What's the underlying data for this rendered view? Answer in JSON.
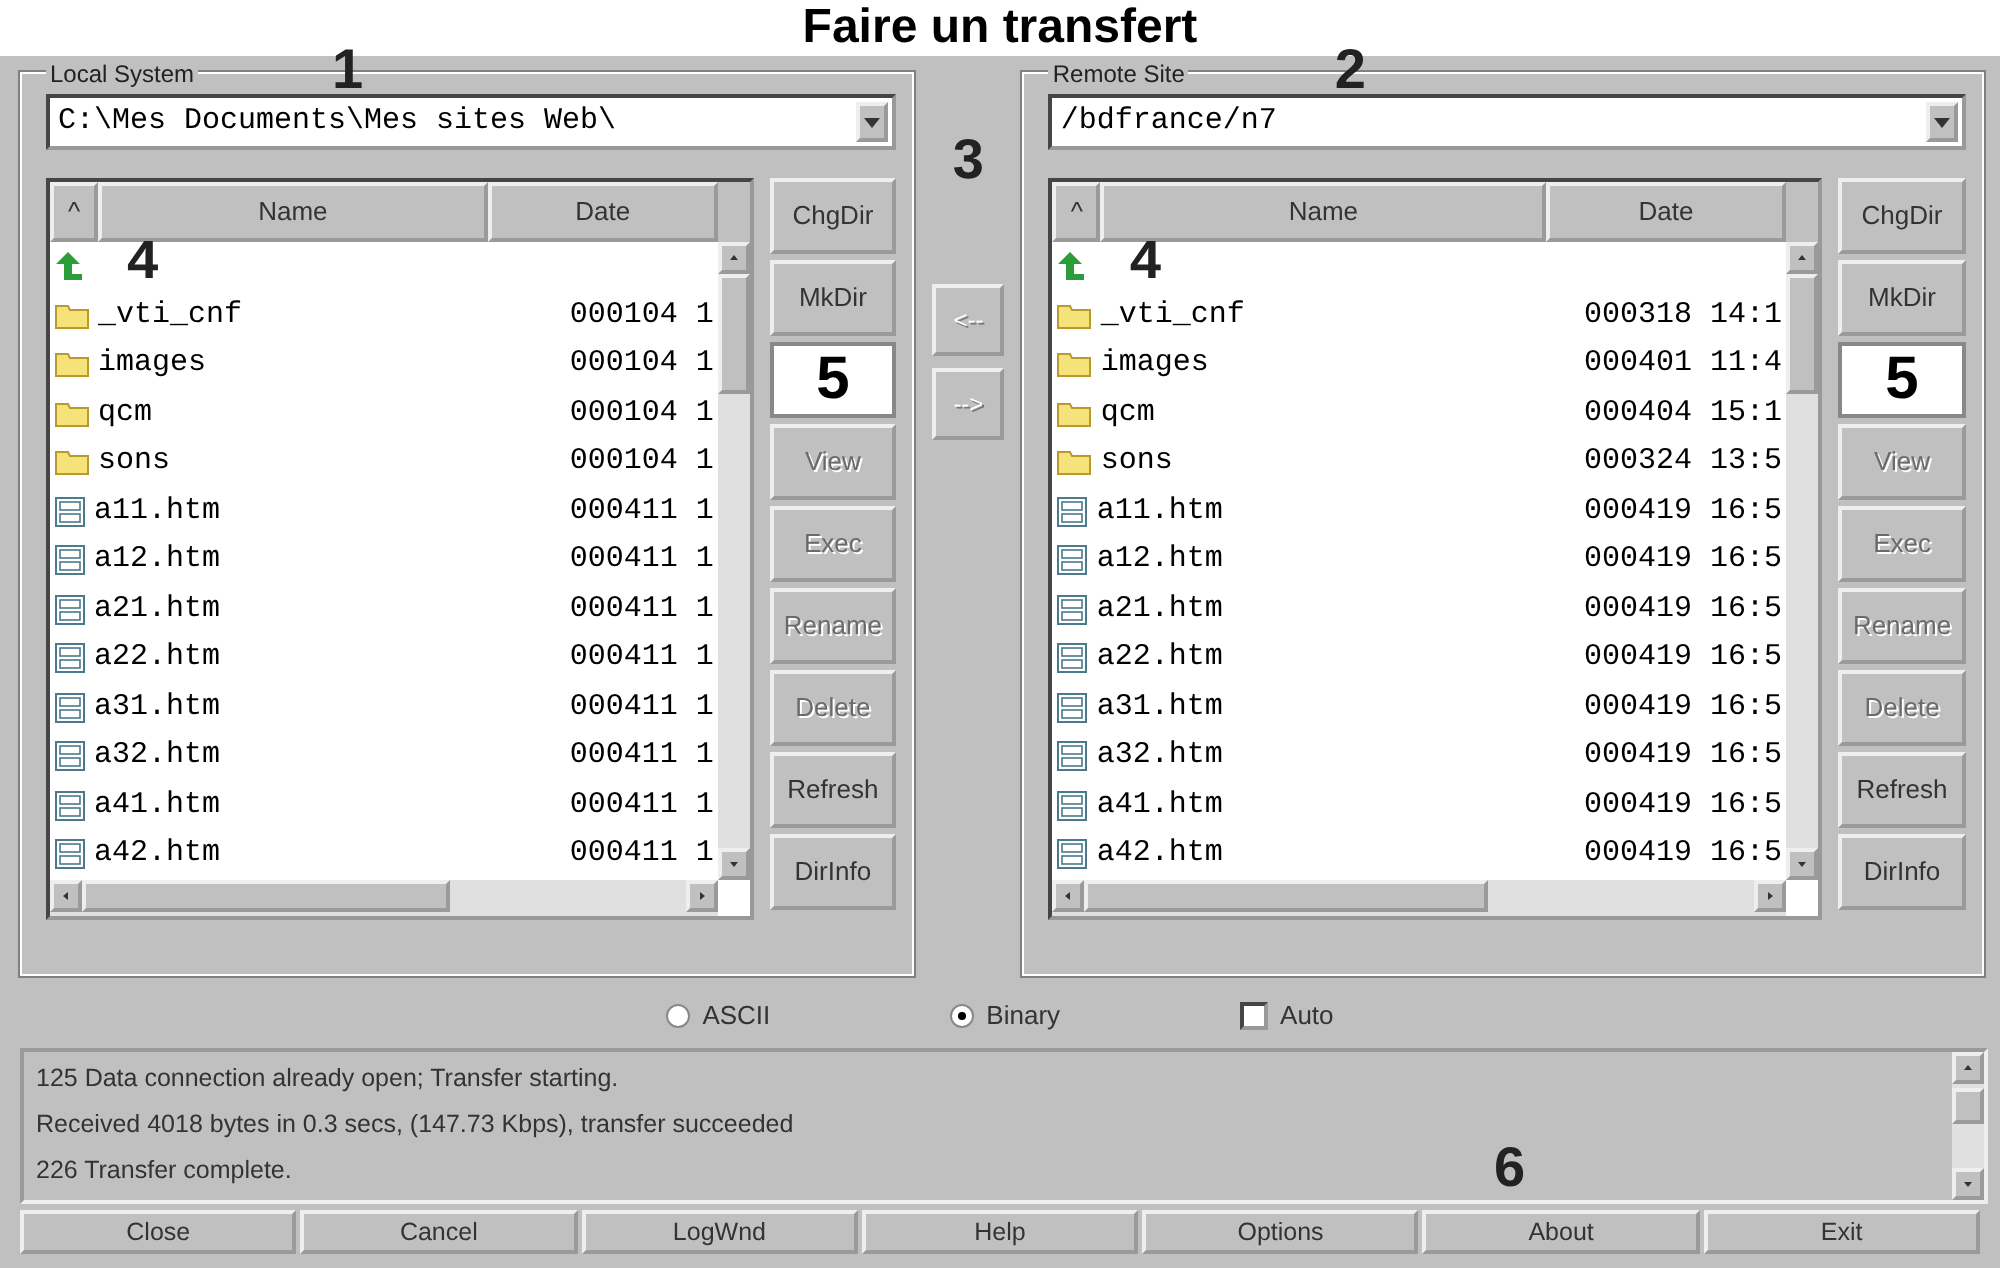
{
  "title": "Faire un transfert",
  "panels": [
    {
      "label": "Local System",
      "marker": "1",
      "path": "C:\\Mes Documents\\Mes sites Web\\",
      "columns": [
        "^",
        "Name",
        "Date"
      ],
      "rows": [
        {
          "kind": "up",
          "marker": "4"
        },
        {
          "kind": "folder",
          "name": "_vti_cnf",
          "date": "000104  1"
        },
        {
          "kind": "folder",
          "name": "images",
          "date": "000104  1"
        },
        {
          "kind": "folder",
          "name": "qcm",
          "date": "000104  1"
        },
        {
          "kind": "folder",
          "name": "sons",
          "date": "000104  1"
        },
        {
          "kind": "file",
          "name": "a11.htm",
          "date": "000411  1"
        },
        {
          "kind": "file",
          "name": "a12.htm",
          "date": "000411  1"
        },
        {
          "kind": "file",
          "name": "a21.htm",
          "date": "000411  1"
        },
        {
          "kind": "file",
          "name": "a22.htm",
          "date": "000411  1"
        },
        {
          "kind": "file",
          "name": "a31.htm",
          "date": "000411  1"
        },
        {
          "kind": "file",
          "name": "a32.htm",
          "date": "000411  1"
        },
        {
          "kind": "file",
          "name": "a41.htm",
          "date": "000411  1"
        },
        {
          "kind": "file",
          "name": "a42.htm",
          "date": "000411  1"
        }
      ],
      "buttons": [
        {
          "kind": "button",
          "label": "ChgDir",
          "disabled": false
        },
        {
          "kind": "button",
          "label": "MkDir",
          "disabled": false
        },
        {
          "kind": "callout",
          "label": "5"
        },
        {
          "kind": "button",
          "label": "View",
          "disabled": true
        },
        {
          "kind": "button",
          "label": "Exec",
          "disabled": true
        },
        {
          "kind": "button",
          "label": "Rename",
          "disabled": true
        },
        {
          "kind": "button",
          "label": "Delete",
          "disabled": true
        },
        {
          "kind": "button",
          "label": "Refresh",
          "disabled": false
        },
        {
          "kind": "button",
          "label": "DirInfo",
          "disabled": false
        }
      ]
    },
    {
      "label": "Remote Site",
      "marker": "2",
      "path": "/bdfrance/n7",
      "columns": [
        "^",
        "Name",
        "Date"
      ],
      "rows": [
        {
          "kind": "up",
          "marker": "4"
        },
        {
          "kind": "folder",
          "name": "_vti_cnf",
          "date": "000318 14:1"
        },
        {
          "kind": "folder",
          "name": "images",
          "date": "000401 11:4"
        },
        {
          "kind": "folder",
          "name": "qcm",
          "date": "000404 15:1"
        },
        {
          "kind": "folder",
          "name": "sons",
          "date": "000324 13:5"
        },
        {
          "kind": "file",
          "name": "a11.htm",
          "date": "000419 16:5"
        },
        {
          "kind": "file",
          "name": "a12.htm",
          "date": "000419 16:5"
        },
        {
          "kind": "file",
          "name": "a21.htm",
          "date": "000419 16:5"
        },
        {
          "kind": "file",
          "name": "a22.htm",
          "date": "000419 16:5"
        },
        {
          "kind": "file",
          "name": "a31.htm",
          "date": "000419 16:5"
        },
        {
          "kind": "file",
          "name": "a32.htm",
          "date": "000419 16:5"
        },
        {
          "kind": "file",
          "name": "a41.htm",
          "date": "000419 16:5"
        },
        {
          "kind": "file",
          "name": "a42.htm",
          "date": "000419 16:5"
        }
      ],
      "buttons": [
        {
          "kind": "button",
          "label": "ChgDir",
          "disabled": false
        },
        {
          "kind": "button",
          "label": "MkDir",
          "disabled": false
        },
        {
          "kind": "callout",
          "label": "5"
        },
        {
          "kind": "button",
          "label": "View",
          "disabled": true
        },
        {
          "kind": "button",
          "label": "Exec",
          "disabled": true
        },
        {
          "kind": "button",
          "label": "Rename",
          "disabled": true
        },
        {
          "kind": "button",
          "label": "Delete",
          "disabled": true
        },
        {
          "kind": "button",
          "label": "Refresh",
          "disabled": false
        },
        {
          "kind": "button",
          "label": "DirInfo",
          "disabled": false
        }
      ]
    }
  ],
  "transfer": {
    "marker": "3",
    "buttons": [
      "<--",
      "-->"
    ]
  },
  "modes": [
    {
      "kind": "radio",
      "label": "ASCII",
      "selected": false
    },
    {
      "kind": "radio",
      "label": "Binary",
      "selected": true
    },
    {
      "kind": "checkbox",
      "label": "Auto",
      "checked": false
    }
  ],
  "log": {
    "marker": "6",
    "lines": [
      "125 Data connection already open; Transfer starting.",
      "Received 4018 bytes in 0.3 secs, (147.73 Kbps), transfer succeeded",
      "226 Transfer complete."
    ]
  },
  "bottom_buttons": [
    "Close",
    "Cancel",
    "LogWnd",
    "Help",
    "Options",
    "About",
    "Exit"
  ]
}
